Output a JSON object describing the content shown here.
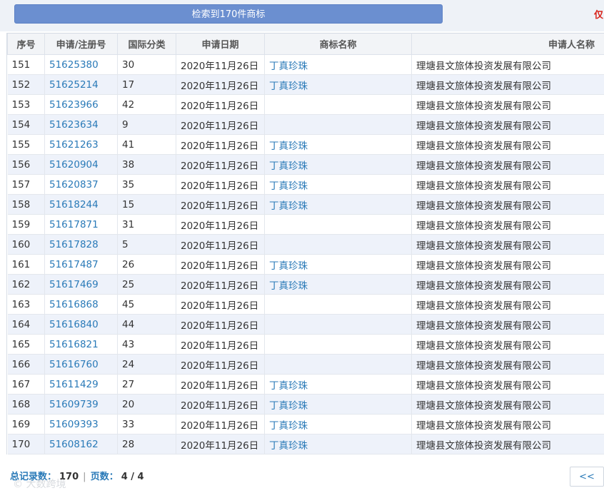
{
  "banner": {
    "text": "检索到170件商标"
  },
  "right_note": "仅",
  "table": {
    "headers": [
      "序号",
      "申请/注册号",
      "国际分类",
      "申请日期",
      "商标名称",
      "申请人名称"
    ],
    "rows": [
      {
        "no": "151",
        "reg": "51625380",
        "cls": "30",
        "date": "2020年11月26日",
        "mark": "丁真珍珠",
        "applicant": "理塘县文旅体投资发展有限公司"
      },
      {
        "no": "152",
        "reg": "51625214",
        "cls": "17",
        "date": "2020年11月26日",
        "mark": "丁真珍珠",
        "applicant": "理塘县文旅体投资发展有限公司"
      },
      {
        "no": "153",
        "reg": "51623966",
        "cls": "42",
        "date": "2020年11月26日",
        "mark": "",
        "applicant": "理塘县文旅体投资发展有限公司"
      },
      {
        "no": "154",
        "reg": "51623634",
        "cls": "9",
        "date": "2020年11月26日",
        "mark": "",
        "applicant": "理塘县文旅体投资发展有限公司"
      },
      {
        "no": "155",
        "reg": "51621263",
        "cls": "41",
        "date": "2020年11月26日",
        "mark": "丁真珍珠",
        "applicant": "理塘县文旅体投资发展有限公司"
      },
      {
        "no": "156",
        "reg": "51620904",
        "cls": "38",
        "date": "2020年11月26日",
        "mark": "丁真珍珠",
        "applicant": "理塘县文旅体投资发展有限公司"
      },
      {
        "no": "157",
        "reg": "51620837",
        "cls": "35",
        "date": "2020年11月26日",
        "mark": "丁真珍珠",
        "applicant": "理塘县文旅体投资发展有限公司"
      },
      {
        "no": "158",
        "reg": "51618244",
        "cls": "15",
        "date": "2020年11月26日",
        "mark": "丁真珍珠",
        "applicant": "理塘县文旅体投资发展有限公司"
      },
      {
        "no": "159",
        "reg": "51617871",
        "cls": "31",
        "date": "2020年11月26日",
        "mark": "",
        "applicant": "理塘县文旅体投资发展有限公司"
      },
      {
        "no": "160",
        "reg": "51617828",
        "cls": "5",
        "date": "2020年11月26日",
        "mark": "",
        "applicant": "理塘县文旅体投资发展有限公司"
      },
      {
        "no": "161",
        "reg": "51617487",
        "cls": "26",
        "date": "2020年11月26日",
        "mark": "丁真珍珠",
        "applicant": "理塘县文旅体投资发展有限公司"
      },
      {
        "no": "162",
        "reg": "51617469",
        "cls": "25",
        "date": "2020年11月26日",
        "mark": "丁真珍珠",
        "applicant": "理塘县文旅体投资发展有限公司"
      },
      {
        "no": "163",
        "reg": "51616868",
        "cls": "45",
        "date": "2020年11月26日",
        "mark": "",
        "applicant": "理塘县文旅体投资发展有限公司"
      },
      {
        "no": "164",
        "reg": "51616840",
        "cls": "44",
        "date": "2020年11月26日",
        "mark": "",
        "applicant": "理塘县文旅体投资发展有限公司"
      },
      {
        "no": "165",
        "reg": "51616821",
        "cls": "43",
        "date": "2020年11月26日",
        "mark": "",
        "applicant": "理塘县文旅体投资发展有限公司"
      },
      {
        "no": "166",
        "reg": "51616760",
        "cls": "24",
        "date": "2020年11月26日",
        "mark": "",
        "applicant": "理塘县文旅体投资发展有限公司"
      },
      {
        "no": "167",
        "reg": "51611429",
        "cls": "27",
        "date": "2020年11月26日",
        "mark": "丁真珍珠",
        "applicant": "理塘县文旅体投资发展有限公司"
      },
      {
        "no": "168",
        "reg": "51609739",
        "cls": "20",
        "date": "2020年11月26日",
        "mark": "丁真珍珠",
        "applicant": "理塘县文旅体投资发展有限公司"
      },
      {
        "no": "169",
        "reg": "51609393",
        "cls": "33",
        "date": "2020年11月26日",
        "mark": "丁真珍珠",
        "applicant": "理塘县文旅体投资发展有限公司"
      },
      {
        "no": "170",
        "reg": "51608162",
        "cls": "28",
        "date": "2020年11月26日",
        "mark": "丁真珍珠",
        "applicant": "理塘县文旅体投资发展有限公司"
      }
    ]
  },
  "footer": {
    "total_label": "总记录数：",
    "total_value": "170",
    "separator": "|",
    "pages_label": "页数：",
    "pages_value": "4 / 4",
    "prev_label": "<<"
  },
  "watermark": "© 大数跨境",
  "colors": {
    "banner": "#6b8fd0",
    "link": "#2a7ab8",
    "alt_row": "#eef2fa",
    "note": "#d9251c"
  }
}
